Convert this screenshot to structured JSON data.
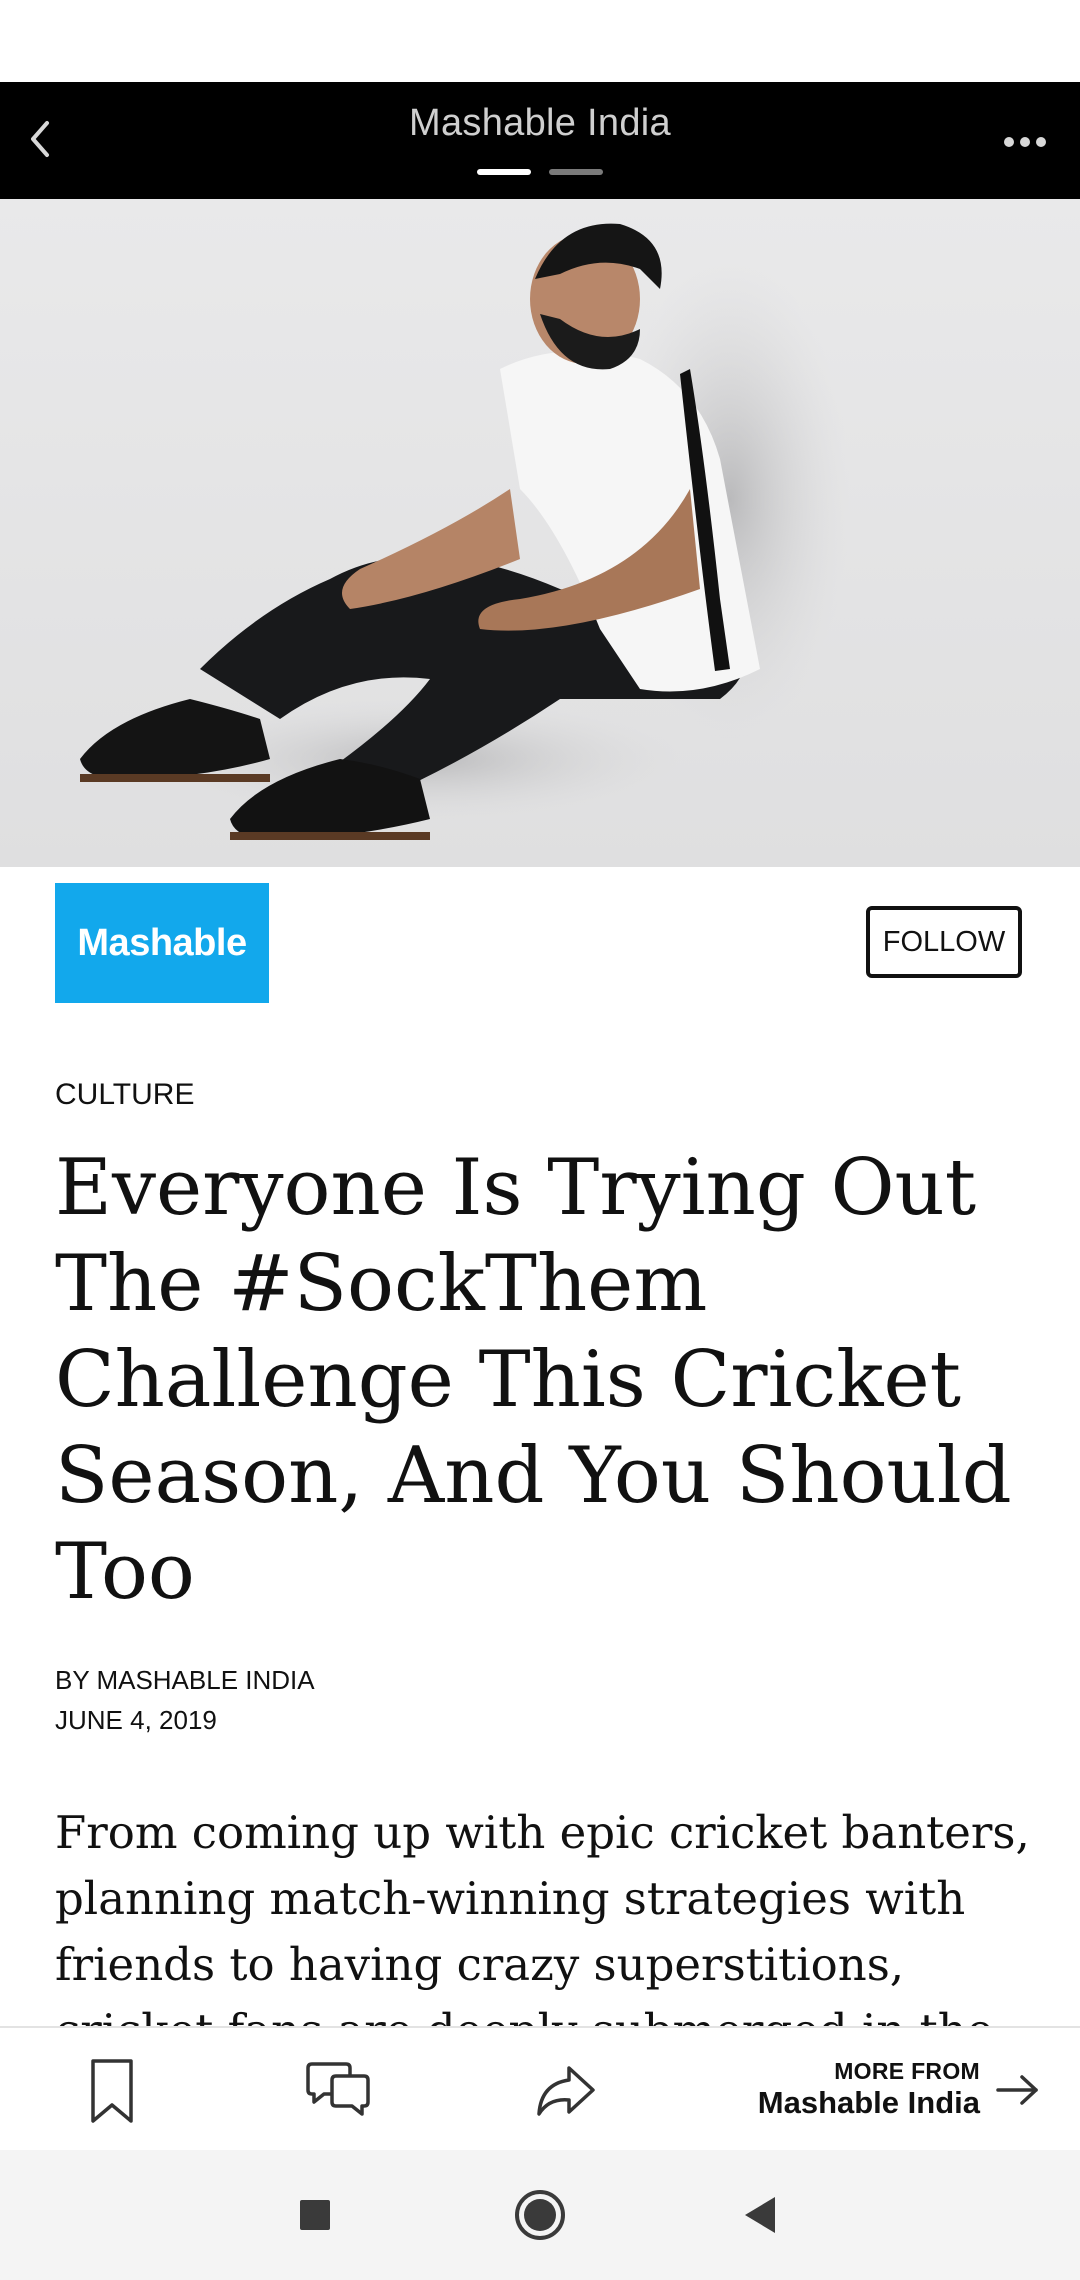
{
  "header": {
    "title": "Mashable India",
    "page_count": 2,
    "active_page": 1
  },
  "publisher": {
    "logo_text": "Mashable",
    "logo_color": "#12a8ec",
    "follow_label": "FOLLOW"
  },
  "article": {
    "category": "CULTURE",
    "headline": "Everyone Is Trying Out The #SockThem Challenge This Cricket Season, And You Should Too",
    "byline": "BY MASHABLE INDIA",
    "date": "JUNE 4, 2019",
    "body": "From coming up with epic cricket banters, planning match-winning strategies with friends to having crazy superstitions, cricket fans are deeply submerged in the"
  },
  "actions": {
    "bookmark_icon": "bookmark-icon",
    "comment_icon": "comment-icon",
    "share_icon": "share-icon",
    "more_from_label": "MORE FROM",
    "more_from_name": "Mashable India"
  },
  "system_nav": {
    "recents_icon": "square-icon",
    "home_icon": "circle-icon",
    "back_icon": "triangle-back-icon"
  }
}
